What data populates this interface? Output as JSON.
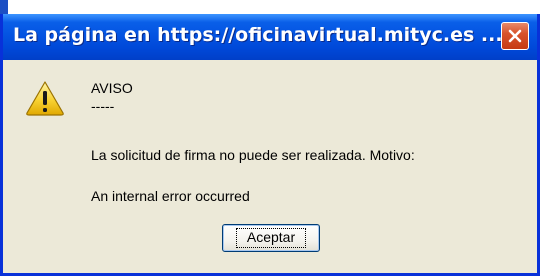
{
  "dialog": {
    "title": "La página en https://oficinavirtual.mityc.es ...",
    "heading": "AVISO",
    "separator": "-----",
    "message_line1": "La solicitud de firma no puede ser realizada. Motivo:",
    "message_line2": "An internal error occurred",
    "ok_label": "Aceptar",
    "close_icon": "close-icon",
    "warning_icon": "warning-icon"
  },
  "colors": {
    "titlebar": "#0454e2",
    "dialog_bg": "#ece9d8",
    "close_button": "#d8532b",
    "warning_triangle": "#f8d233"
  }
}
